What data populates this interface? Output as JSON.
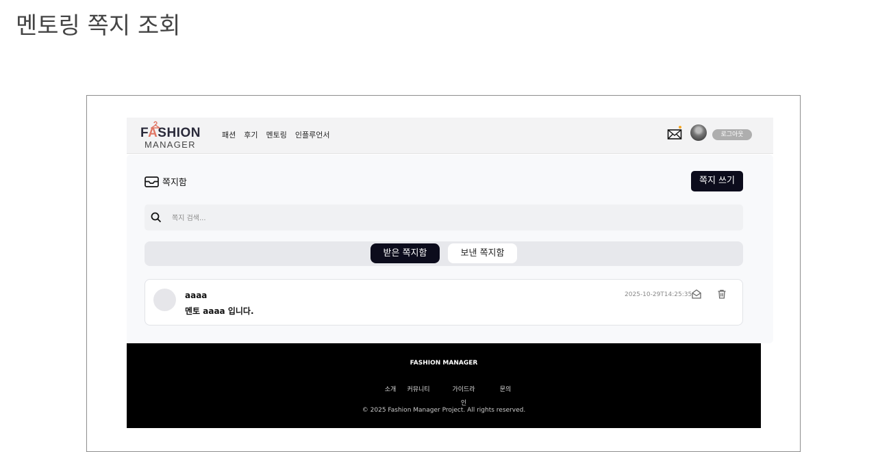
{
  "page_title": "멘토링 쪽지 조회",
  "nav": {
    "logo_top_pre": "F",
    "logo_top_a": "A",
    "logo_top_post": "SHION",
    "logo_bottom": "MANAGER",
    "links": [
      "패션",
      "후기",
      "멘토링",
      "인플루언서"
    ],
    "logout_label": "로그아웃"
  },
  "inbox": {
    "label": "쪽지함",
    "write_button": "쪽지 쓰기",
    "search_placeholder": "쪽지 검색...",
    "tabs": [
      "받은 쪽지함",
      "보낸 쪽지함"
    ],
    "messages": [
      {
        "sender": "aaaa",
        "body": "멘토 aaaa 입니다.",
        "time": "2025-10-29T14:25:35"
      }
    ]
  },
  "footer": {
    "title": "FASHION MANAGER",
    "links": [
      "소개",
      "커뮤니티",
      "가이드라인",
      "문의"
    ],
    "copyright": "© 2025 Fashion Manager Project. All rights reserved."
  },
  "colors": {
    "accent_dark": "#0c0c1c",
    "logo_accent": "#e07563",
    "notification_dot": "#f5a623"
  },
  "icons": [
    "hanger-icon",
    "mail-icon",
    "inbox-icon",
    "search-icon",
    "open-envelope-icon",
    "trash-icon"
  ]
}
